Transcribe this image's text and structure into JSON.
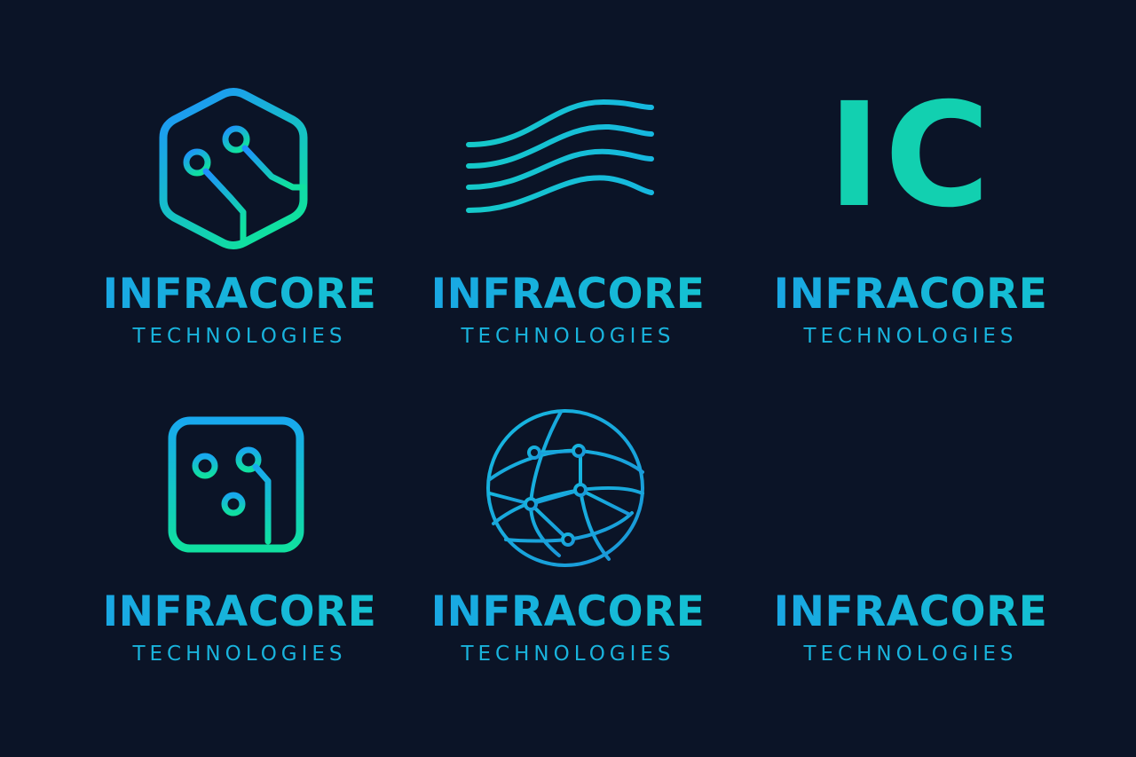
{
  "colors": {
    "background": "#0b1427",
    "accent_blue": "#1e90ff",
    "accent_cyan": "#16b6e0",
    "accent_green": "#10e0a0"
  },
  "logos": [
    {
      "icon": "hexagon-circuit-icon",
      "name": "INFRACORE",
      "tagline": "TECHNOLOGIES"
    },
    {
      "icon": "wave-lines-icon",
      "name": "INFRACORE",
      "tagline": "TECHNOLOGIES"
    },
    {
      "icon": "ic-monogram-icon",
      "monogram": "IC",
      "name": "INFRACORE",
      "tagline": "TECHNOLOGIES"
    },
    {
      "icon": "square-circuit-icon",
      "name": "INFRACORE",
      "tagline": "TECHNOLOGIES"
    },
    {
      "icon": "network-globe-icon",
      "name": "INFRACORE",
      "tagline": "TECHNOLOGIES"
    },
    {
      "icon": "",
      "name": "INFRACORE",
      "tagline": "TECHNOLOGIES"
    }
  ]
}
